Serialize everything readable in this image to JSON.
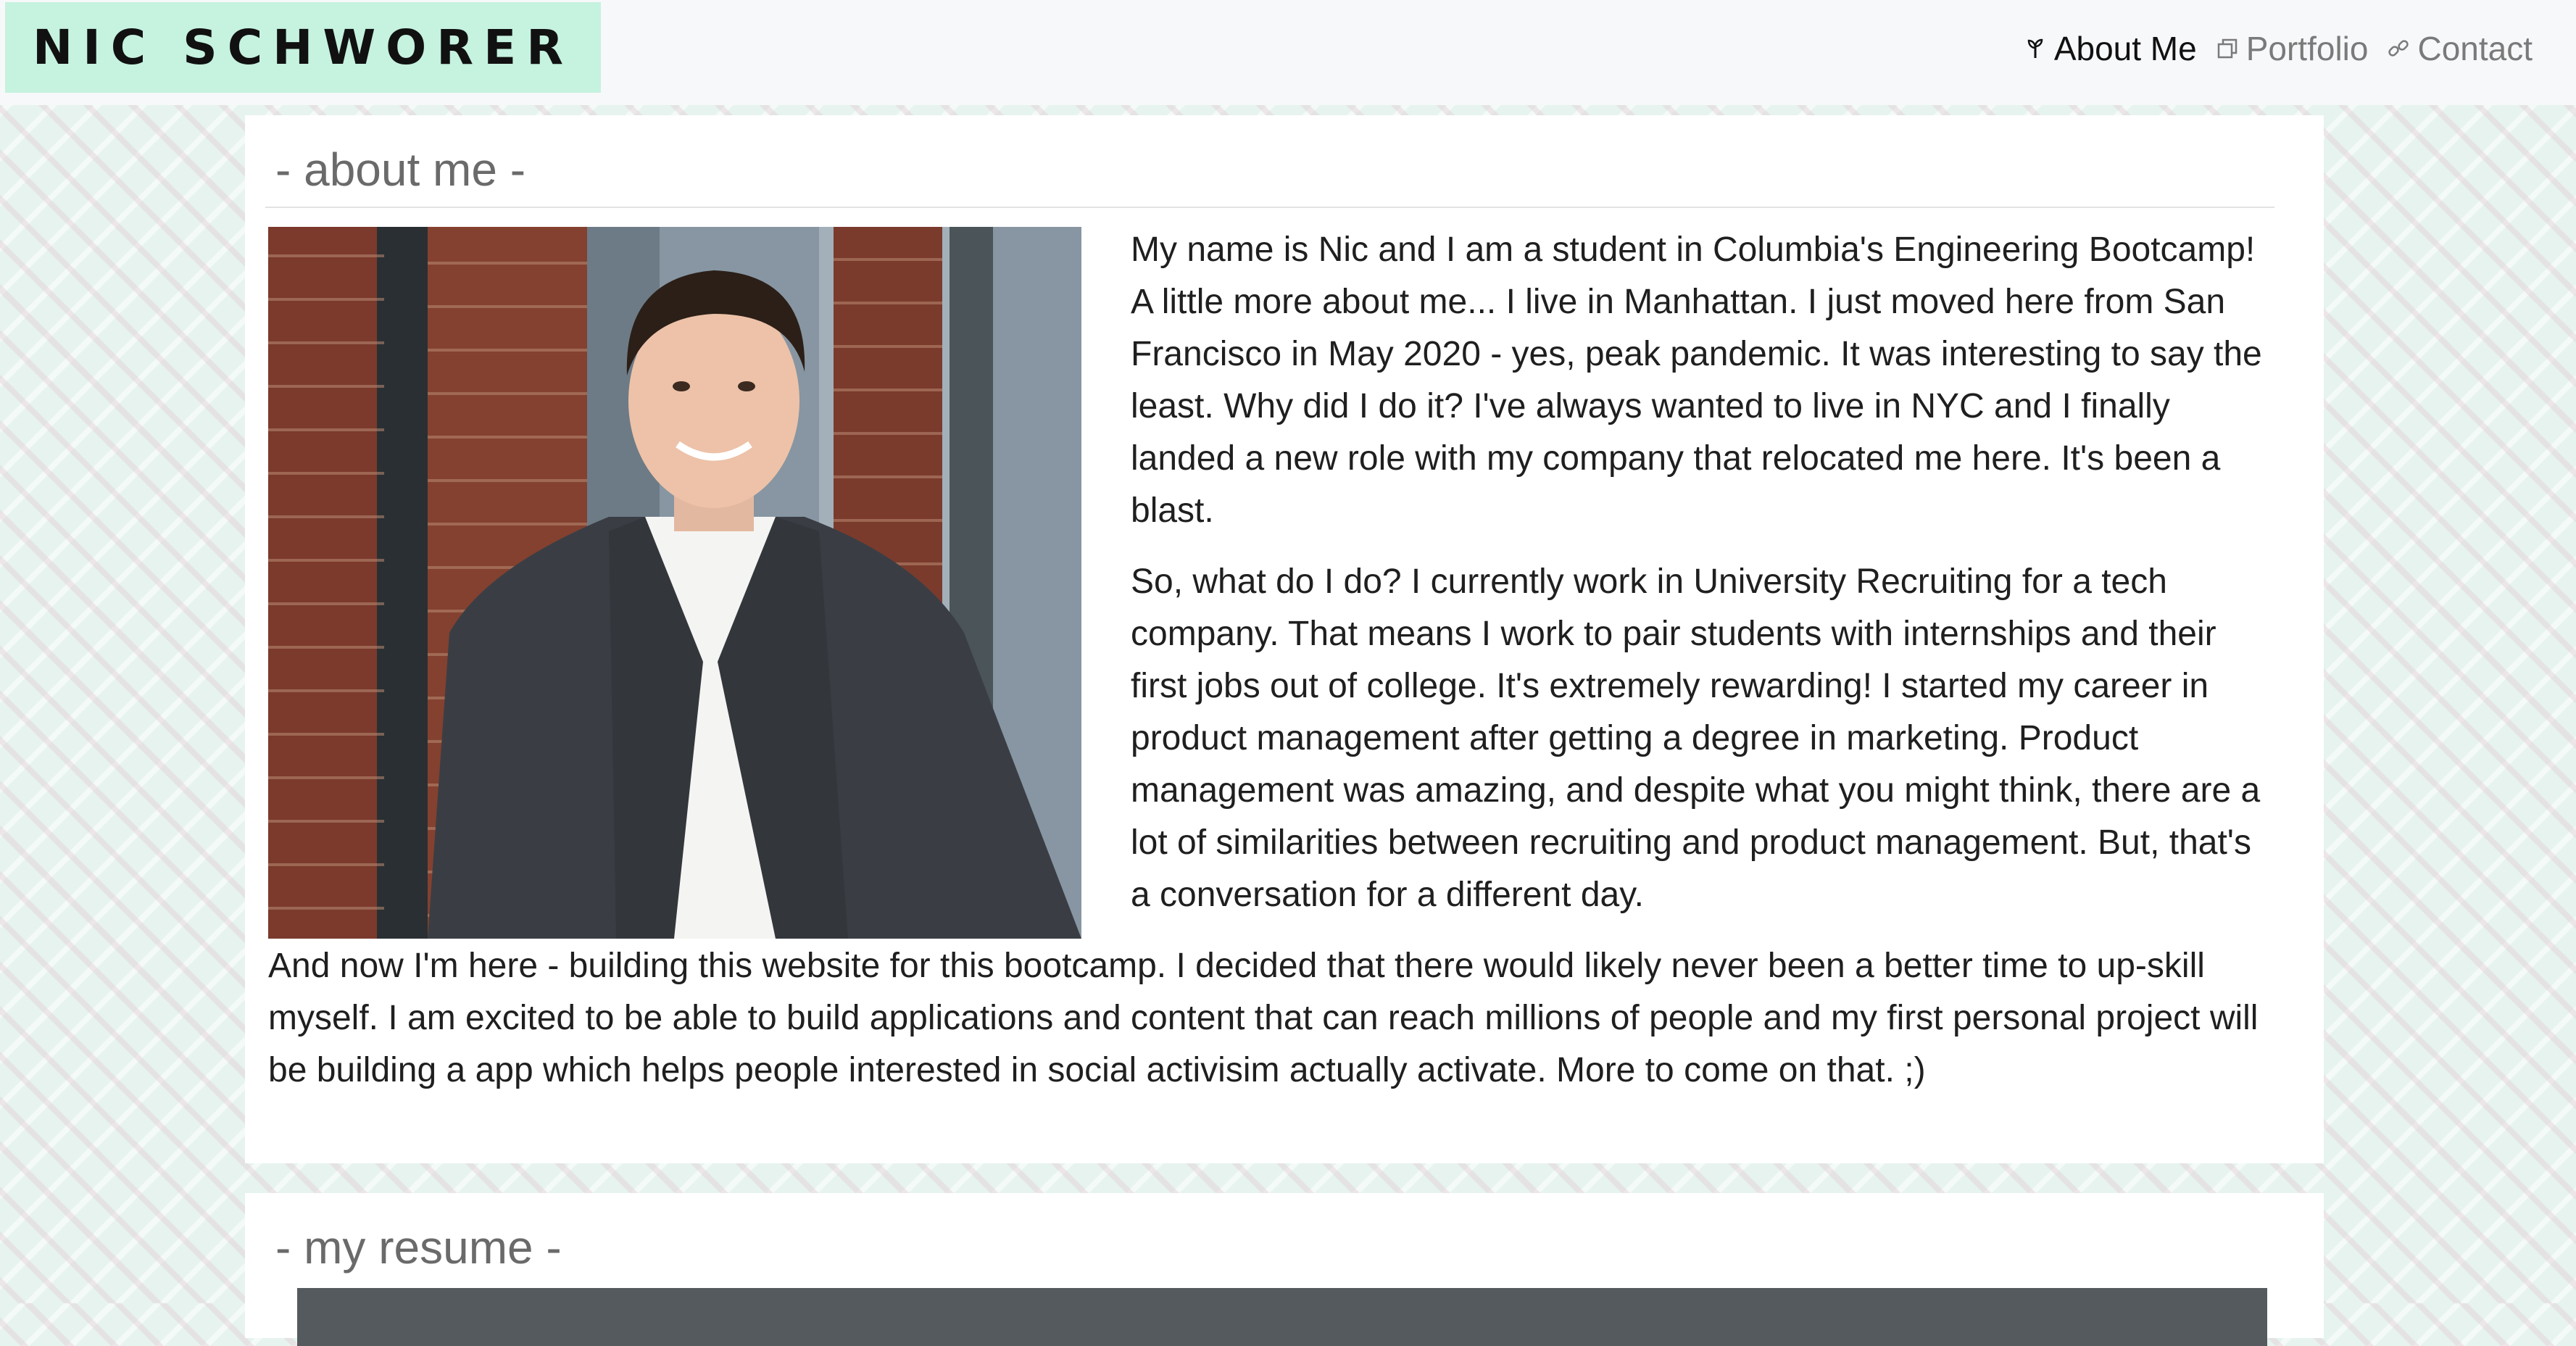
{
  "header": {
    "brand": "NIC SCHWORER",
    "nav": [
      {
        "label": "About Me",
        "icon": "seedling-icon",
        "active": true
      },
      {
        "label": "Portfolio",
        "icon": "copy-icon",
        "active": false
      },
      {
        "label": "Contact",
        "icon": "link-icon",
        "active": false
      }
    ]
  },
  "about": {
    "title": "- about me -",
    "paragraphs": [
      "My name is Nic and I am a student in Columbia's Engineering Bootcamp! A little more about me... I live in Manhattan. I just moved here from San Francisco in May 2020 - yes, peak pandemic. It was interesting to say the least. Why did I do it? I've always wanted to live in NYC and I finally landed a new role with my company that relocated me here. It's been a blast.",
      "So, what do I do? I currently work in University Recruiting for a tech company. That means I work to pair students with internships and their first jobs out of college. It's extremely rewarding! I started my career in product management after getting a degree in marketing. Product management was amazing, and despite what you might think, there are a lot of similarities between recruiting and product management. But, that's a conversation for a different day.",
      "And now I'm here - building this website for this bootcamp. I decided that there would likely never been a better time to up-skill myself. I am excited to be able to build applications and content that can reach millions of people and my first personal project will be building a app which helps people interested in social activisim actually activate. More to come on that. ;)"
    ]
  },
  "resume": {
    "title": "- my resume -"
  },
  "colors": {
    "brand_bg": "#c6f2e0",
    "page_bg": "#e6f3ee",
    "card_bg": "#ffffff",
    "nav_active": "#111111",
    "nav_inactive": "#7a7a7a",
    "resume_bar": "#555a5e"
  }
}
